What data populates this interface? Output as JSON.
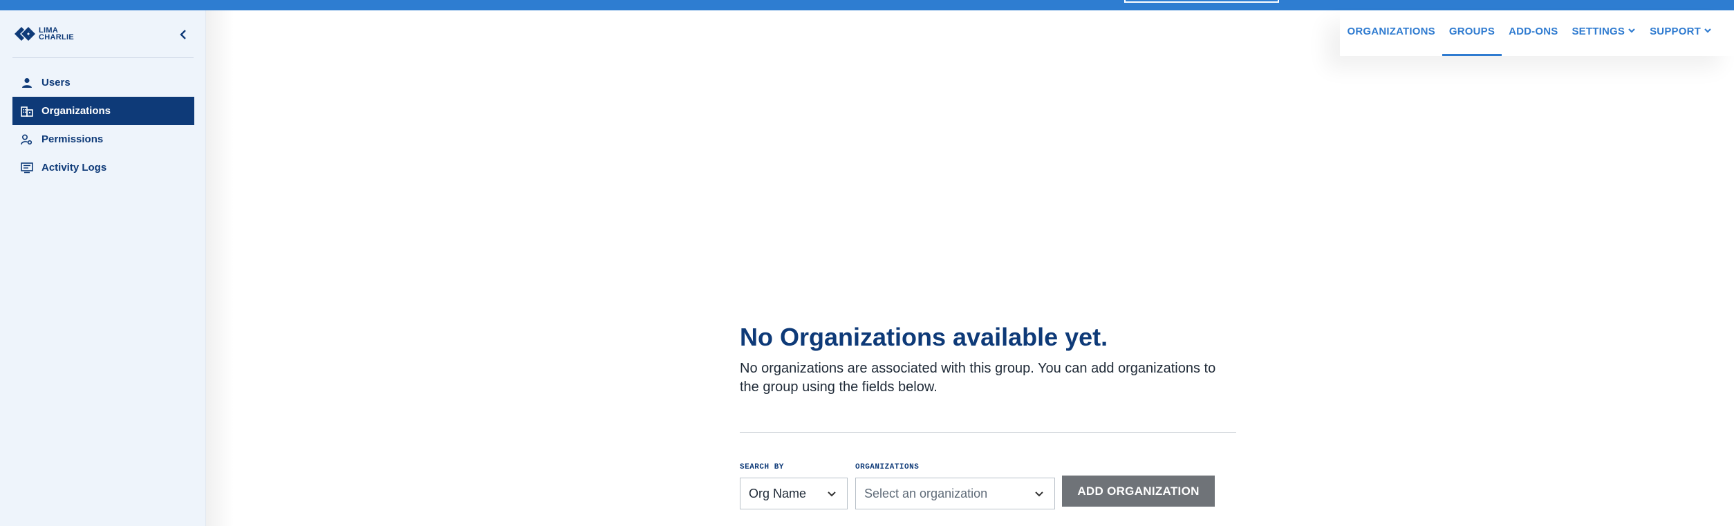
{
  "brand": {
    "logo_line1": "LIMA",
    "logo_line2": "CHARLIE"
  },
  "sidebar": {
    "items": [
      {
        "label": "Users",
        "icon": "user-icon",
        "active": false
      },
      {
        "label": "Organizations",
        "icon": "building-icon",
        "active": true
      },
      {
        "label": "Permissions",
        "icon": "user-key-icon",
        "active": false
      },
      {
        "label": "Activity Logs",
        "icon": "activity-log-icon",
        "active": false
      }
    ]
  },
  "topnav": {
    "tabs": [
      {
        "label": "ORGANIZATIONS",
        "active": false
      },
      {
        "label": "GROUPS",
        "active": true
      },
      {
        "label": "ADD-ONS",
        "active": false
      },
      {
        "label": "SETTINGS",
        "active": false,
        "dropdown": true
      },
      {
        "label": "SUPPORT",
        "active": false,
        "dropdown": true
      }
    ]
  },
  "empty_state": {
    "title": "No Organizations available yet.",
    "description": "No organizations are associated with this group. You can add organizations to the group using the fields below."
  },
  "form": {
    "search_by_label": "SEARCH BY",
    "search_by_value": "Org Name",
    "organizations_label": "ORGANIZATIONS",
    "organizations_placeholder": "Select an organization",
    "add_button_label": "ADD ORGANIZATION"
  },
  "colors": {
    "brand_navy": "#0e3a78",
    "accent_blue": "#2f7bd0",
    "button_gray": "#6f7378"
  }
}
